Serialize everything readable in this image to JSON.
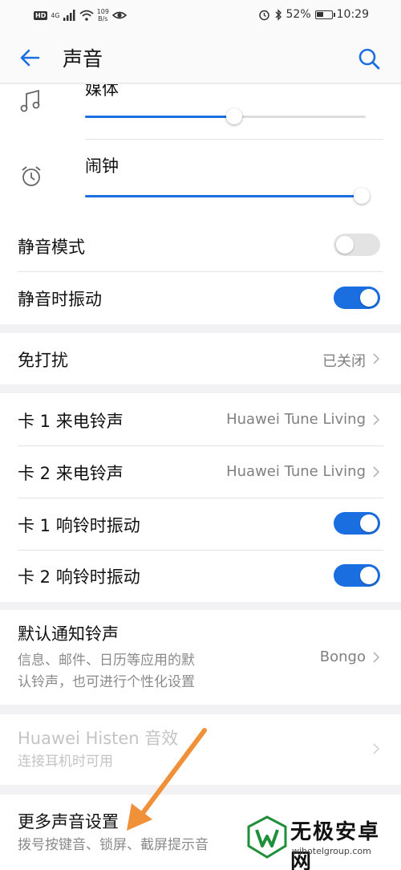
{
  "status_bar": {
    "hd": "HD",
    "network": "4G",
    "speed_value": "109",
    "speed_unit": "B/s",
    "battery": "52%",
    "time": "10:29",
    "battery_level": 0.52,
    "icons": [
      "signal-icon",
      "wifi-icon",
      "eye-icon",
      "alarm-icon",
      "bluetooth-icon",
      "battery-icon"
    ]
  },
  "header": {
    "title": "声音",
    "back_icon": "arrow-left-icon",
    "search_icon": "search-icon"
  },
  "volume": {
    "media": {
      "label": "媒体",
      "icon": "music-note-icon",
      "level": 0.53
    },
    "alarm": {
      "label": "闹钟",
      "icon": "alarm-clock-icon",
      "level": 0.985
    }
  },
  "silent_group": {
    "silent_mode": {
      "label": "静音模式",
      "on": false
    },
    "vibrate_when_silent": {
      "label": "静音时振动",
      "on": true
    }
  },
  "dnd": {
    "label": "免打扰",
    "value": "已关闭"
  },
  "ringtone_group": {
    "sim1_ringtone": {
      "label": "卡 1 来电铃声",
      "value": "Huawei Tune Living"
    },
    "sim2_ringtone": {
      "label": "卡 2 来电铃声",
      "value": "Huawei Tune Living"
    },
    "sim1_vibrate": {
      "label": "卡 1 响铃时振动",
      "on": true
    },
    "sim2_vibrate": {
      "label": "卡 2 响铃时振动",
      "on": true
    }
  },
  "notification": {
    "label": "默认通知铃声",
    "desc1": "信息、邮件、日历等应用的默",
    "desc2": "认铃声，也可进行个性化设置",
    "value": "Bongo"
  },
  "histen": {
    "label": "Huawei Histen 音效",
    "desc": "连接耳机时可用"
  },
  "more": {
    "label": "更多声音设置",
    "desc": "拨号按键音、锁屏、截屏提示音"
  },
  "watermark": {
    "name": "无极安卓网",
    "url": "wjhotelgroup.com"
  },
  "colors": {
    "accent": "#1a6ee0",
    "arrow": "#f0913a",
    "background": "#f2f2f4"
  }
}
